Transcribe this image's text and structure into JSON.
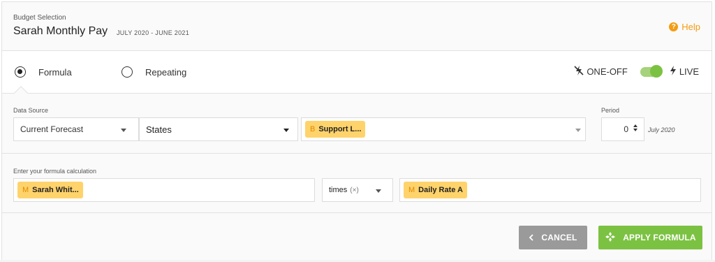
{
  "header": {
    "eyebrow": "Budget Selection",
    "title": "Sarah Monthly Pay",
    "date_range": "JULY 2020 - JUNE 2021",
    "help_label": "Help"
  },
  "mode": {
    "formula_label": "Formula",
    "repeating_label": "Repeating",
    "selected": "Formula",
    "one_off_label": "ONE-OFF",
    "live_label": "LIVE",
    "toggle_state": "on"
  },
  "data_source": {
    "label": "Data Source",
    "source_value": "Current Forecast",
    "states_value": "States",
    "item_tag": "B",
    "item_value": "Support L..."
  },
  "period": {
    "label": "Period",
    "value": "0",
    "unit": "July 2020"
  },
  "formula": {
    "label": "Enter your formula calculation",
    "left_tag": "M",
    "left_value": "Sarah Whit...",
    "operator": "times",
    "operator_symbol": "(×)",
    "right_tag": "M",
    "right_value": "Daily Rate A"
  },
  "footer": {
    "cancel_label": "CANCEL",
    "apply_label": "APPLY FORMULA"
  },
  "colors": {
    "accent": "#f39c12",
    "apply_green": "#7cc242",
    "chip_yellow": "#ffd36b",
    "cancel_gray": "#9a9a9a"
  }
}
